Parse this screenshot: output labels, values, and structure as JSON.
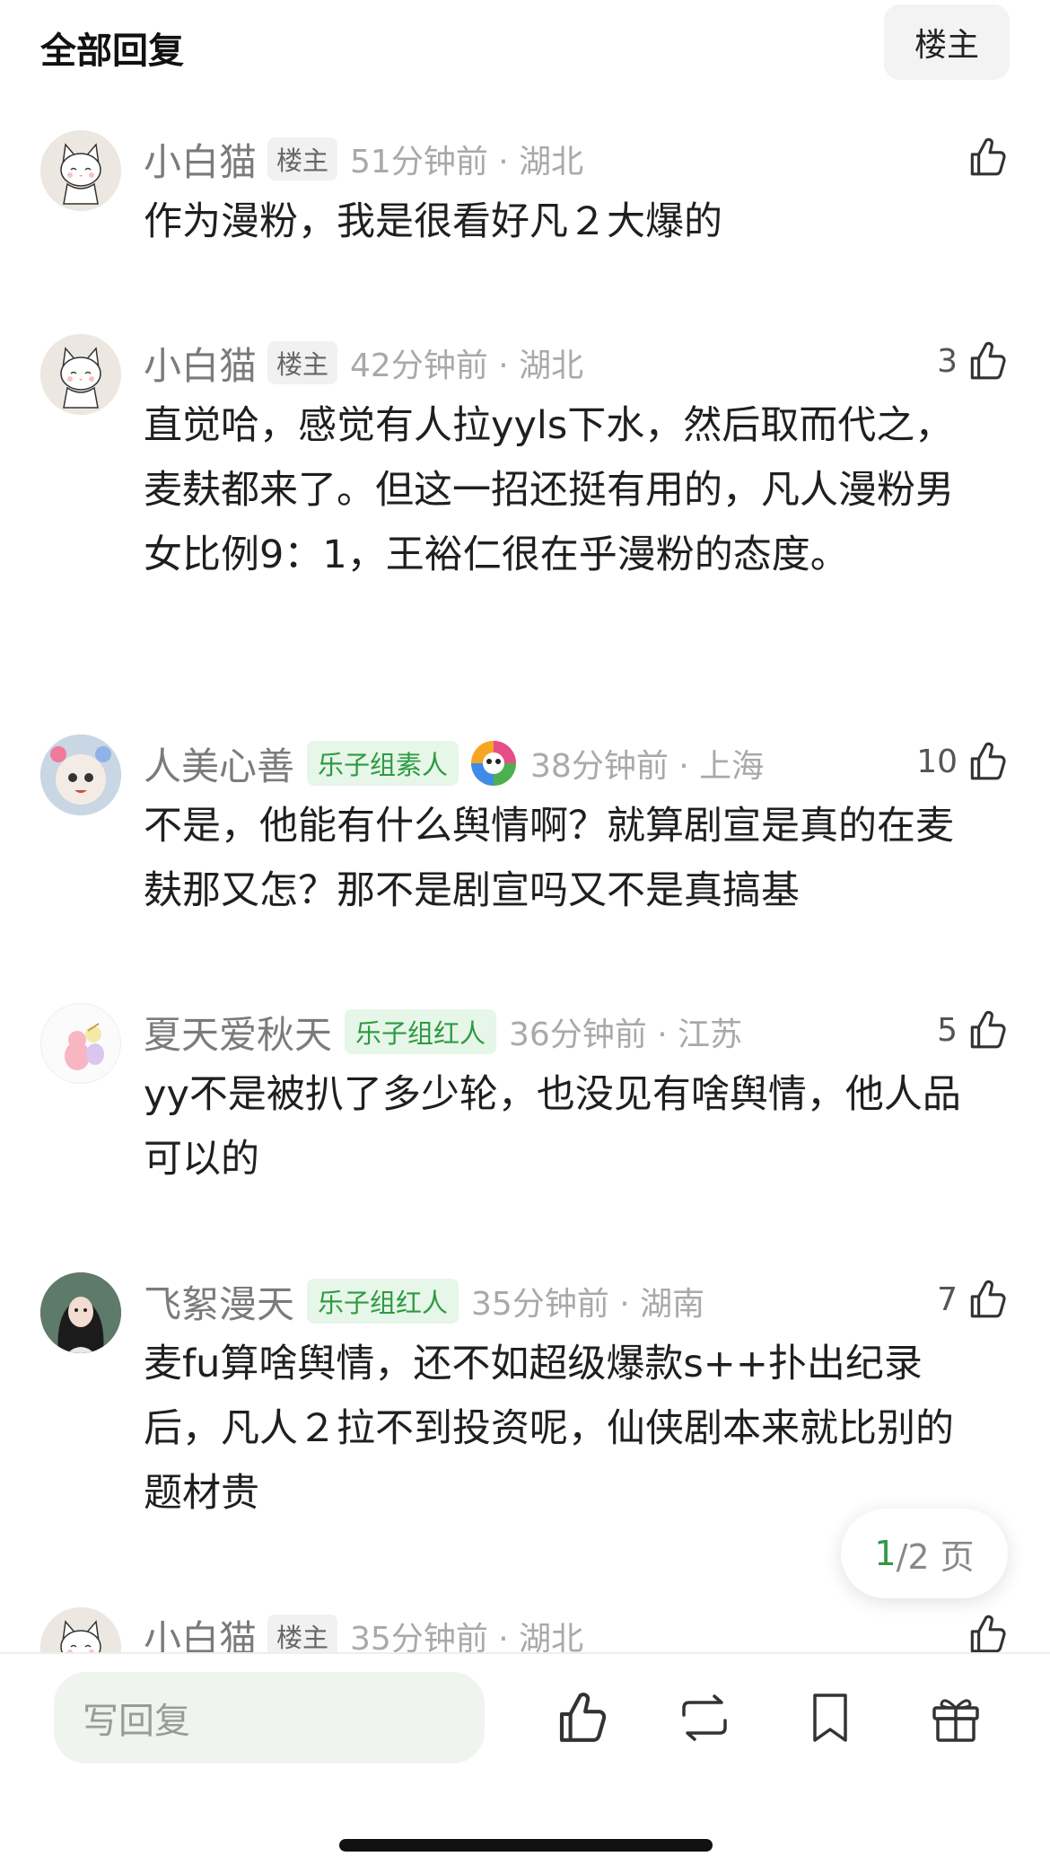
{
  "header": {
    "title": "全部回复",
    "owner_filter_label": "楼主"
  },
  "comments": [
    {
      "user": "小白猫",
      "badge": "楼主",
      "time_loc": "51分钟前 · 湖北",
      "likes": "",
      "text": "作为漫粉，我是很看好凡２大爆的"
    },
    {
      "user": "小白猫",
      "badge": "楼主",
      "time_loc": "42分钟前 · 湖北",
      "likes": "3",
      "text": "直觉哈，感觉有人拉yyls下水，然后取而代之，麦麸都来了。但这一招还挺有用的，凡人漫粉男女比例9：1，王裕仁很在乎漫粉的态度。"
    },
    {
      "user": "人美心善",
      "badge": "乐子组素人",
      "time_loc": "38分钟前 · 上海",
      "likes": "10",
      "text": "不是，他能有什么舆情啊？就算剧宣是真的在麦麸那又怎？那不是剧宣吗又不是真搞基"
    },
    {
      "user": "夏天爱秋天",
      "badge": "乐子组红人",
      "time_loc": "36分钟前 · 江苏",
      "likes": "5",
      "text": "yy不是被扒了多少轮，也没见有啥舆情，他人品可以的"
    },
    {
      "user": "飞絮漫天",
      "badge": "乐子组红人",
      "time_loc": "35分钟前 · 湖南",
      "likes": "7",
      "text": "麦fu算啥舆情，还不如超级爆款s++扑出纪录后，凡人２拉不到投资呢，仙侠剧本来就比别的题材贵"
    },
    {
      "user": "小白猫",
      "badge": "楼主",
      "time_loc": "35分钟前 · 湖北",
      "likes": "",
      "text": ""
    }
  ],
  "pager": {
    "current": "1",
    "total": "/2 页"
  },
  "bottom_bar": {
    "reply_placeholder": "写回复"
  },
  "icons": {
    "like": "thumbs-up-icon",
    "repost": "repost-icon",
    "bookmark": "bookmark-icon",
    "gift": "gift-icon",
    "medal": "rainbow-medal-icon"
  },
  "colors": {
    "accent_green": "#2e9a43",
    "badge_green_bg": "#e6f6e8",
    "muted_text": "#a9a9a9"
  }
}
